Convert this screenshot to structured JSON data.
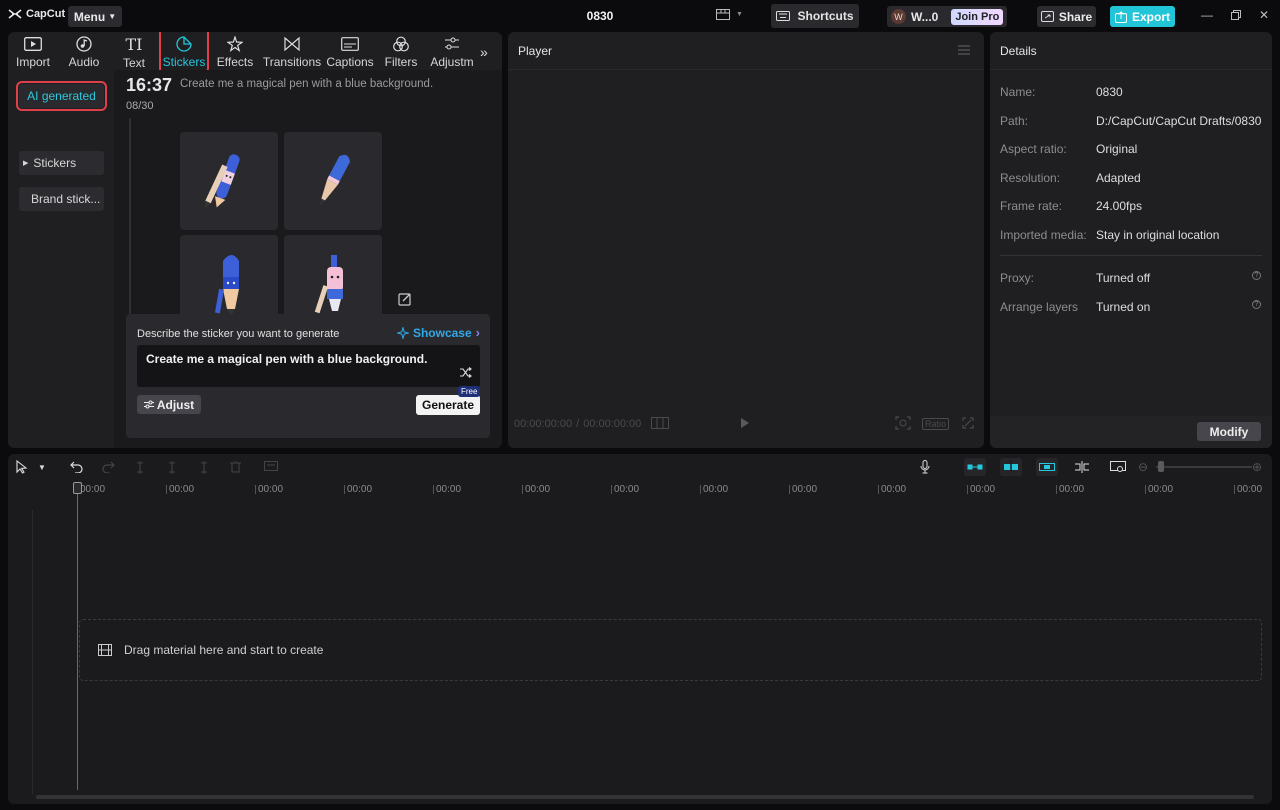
{
  "app": {
    "logo_text": "CapCut",
    "menu_label": "Menu",
    "project_title": "0830",
    "shortcuts_label": "Shortcuts",
    "user_initial": "W",
    "user_name": "W...0",
    "join_pro_label": "Join Pro",
    "share_label": "Share",
    "export_label": "Export",
    "accent_color": "#22c5d8"
  },
  "tabs": [
    {
      "label": "Import",
      "icon": "import-icon"
    },
    {
      "label": "Audio",
      "icon": "audio-icon"
    },
    {
      "label": "Text",
      "icon": "text-icon"
    },
    {
      "label": "Stickers",
      "icon": "sticker-icon",
      "active": true
    },
    {
      "label": "Effects",
      "icon": "effects-icon"
    },
    {
      "label": "Transitions",
      "icon": "transitions-icon"
    },
    {
      "label": "Captions",
      "icon": "captions-icon"
    },
    {
      "label": "Filters",
      "icon": "filters-icon"
    },
    {
      "label": "Adjustm",
      "icon": "adjust-icon"
    }
  ],
  "subnav": [
    {
      "label": "AI generated",
      "active": true
    },
    {
      "label": "Stickers"
    },
    {
      "label": "Brand stick..."
    }
  ],
  "history": {
    "time": "16:37",
    "date": "08/30",
    "prompt": "Create me a magical pen with a blue background."
  },
  "generator": {
    "label": "Describe the sticker you want to generate",
    "showcase_label": "Showcase",
    "input_value": "Create me a magical pen with a blue background.",
    "adjust_label": "Adjust",
    "generate_label": "Generate",
    "free_badge": "Free"
  },
  "player": {
    "title": "Player",
    "current_time": "00:00:00:00",
    "total_time": "00:00:00:00",
    "ratio_label": "Ratio"
  },
  "details": {
    "title": "Details",
    "rows": [
      {
        "label": "Name:",
        "value": "0830"
      },
      {
        "label": "Path:",
        "value": "D:/CapCut/CapCut Drafts/0830"
      },
      {
        "label": "Aspect ratio:",
        "value": "Original"
      },
      {
        "label": "Resolution:",
        "value": "Adapted"
      },
      {
        "label": "Frame rate:",
        "value": "24.00fps"
      },
      {
        "label": "Imported media:",
        "value": "Stay in original location"
      }
    ],
    "extra_rows": [
      {
        "label": "Proxy:",
        "value": "Turned off"
      },
      {
        "label": "Arrange layers",
        "value": "Turned on"
      }
    ],
    "modify_label": "Modify"
  },
  "timeline": {
    "ticks": [
      "00:00",
      "00:00",
      "00:00",
      "00:00",
      "00:00",
      "00:00",
      "00:00",
      "00:00",
      "00:00",
      "00:00",
      "00:00",
      "00:00",
      "00:00",
      "00:00"
    ],
    "drop_text": "Drag material here and start to create"
  }
}
